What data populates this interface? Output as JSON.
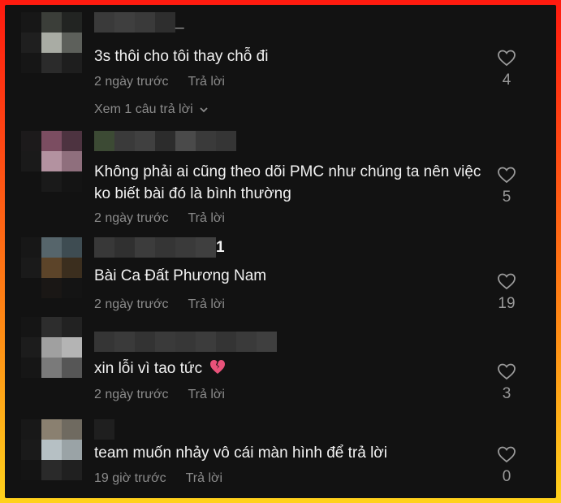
{
  "comments": [
    {
      "text": "3s thôi cho tôi thay chỗ đi",
      "time": "2 ngày trước",
      "reply_label": "Trả lời",
      "likes": "4",
      "username_suffix": "_",
      "view_replies": "Xem 1 câu trả lời"
    },
    {
      "text": "Không phải ai cũng theo dõi PMC như chúng ta nên việc ko biết bài đó là bình thường",
      "time": "2 ngày trước",
      "reply_label": "Trả lời",
      "likes": "5",
      "username_suffix": ""
    },
    {
      "text": "Bài Ca Đất Phương Nam",
      "time": "2 ngày trước",
      "reply_label": "Trả lời",
      "likes": "19",
      "username_suffix": "1"
    },
    {
      "text": "xin lỗi vì tao tức",
      "time": "2 ngày trước",
      "reply_label": "Trả lời",
      "likes": "3",
      "username_suffix": "",
      "emoji": "broken-heart-icon"
    },
    {
      "text": "team muốn nhảy vô cái màn hình để trả lời",
      "time": "19 giờ trước",
      "reply_label": "Trả lời",
      "likes": "0",
      "username_suffix": ""
    }
  ],
  "colors": {
    "background": "#121212",
    "text": "#f2f2f2",
    "meta": "#8b8b8b",
    "frame_top": "#ff1a0f",
    "frame_bottom": "#ffd21c"
  }
}
